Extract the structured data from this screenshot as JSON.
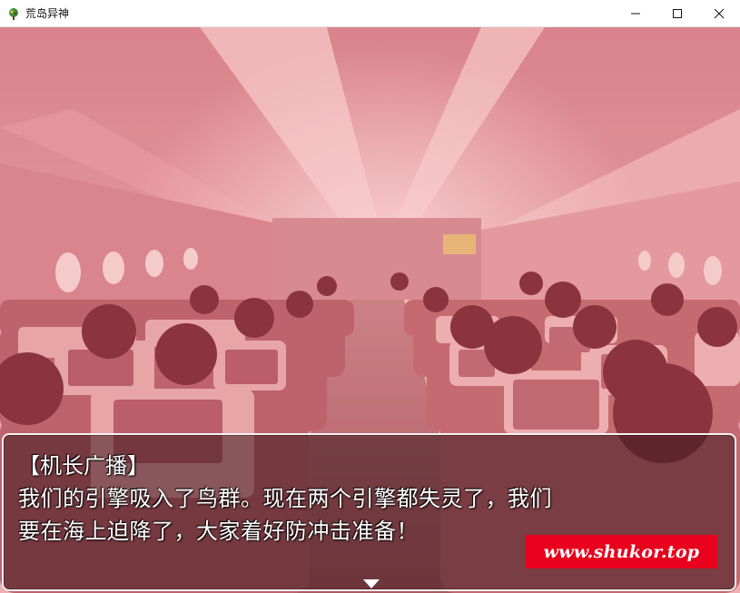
{
  "window": {
    "title": "荒岛异神",
    "icon": "game-app-icon",
    "controls": {
      "minimize_icon": "minimize-icon",
      "maximize_icon": "maximize-icon",
      "close_icon": "close-icon"
    }
  },
  "scene": {
    "background": "airplane-cabin-interior",
    "tint_color": "#e0606a"
  },
  "dialogue": {
    "speaker": "【机长广播】",
    "lines": [
      "我们的引擎吸入了鸟群。现在两个引擎都失灵了，我们",
      "要在海上迫降了，大家着好防冲击准备！"
    ],
    "continue_indicator": "down-triangle-icon"
  },
  "watermark": {
    "text": "www.shukor.top",
    "color": "#e8001c"
  }
}
